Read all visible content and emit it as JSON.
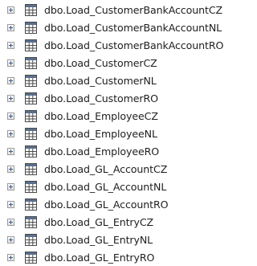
{
  "tree": {
    "items": [
      {
        "label": "dbo.Load_CustomerBankAccountCZ"
      },
      {
        "label": "dbo.Load_CustomerBankAccountNL"
      },
      {
        "label": "dbo.Load_CustomerBankAccountRO"
      },
      {
        "label": "dbo.Load_CustomerCZ"
      },
      {
        "label": "dbo.Load_CustomerNL"
      },
      {
        "label": "dbo.Load_CustomerRO"
      },
      {
        "label": "dbo.Load_EmployeeCZ"
      },
      {
        "label": "dbo.Load_EmployeeNL"
      },
      {
        "label": "dbo.Load_EmployeeRO"
      },
      {
        "label": "dbo.Load_GL_AccountCZ"
      },
      {
        "label": "dbo.Load_GL_AccountNL"
      },
      {
        "label": "dbo.Load_GL_AccountRO"
      },
      {
        "label": "dbo.Load_GL_EntryCZ"
      },
      {
        "label": "dbo.Load_GL_EntryNL"
      },
      {
        "label": "dbo.Load_GL_EntryRO"
      }
    ],
    "expander_icon": "plus-expander-icon",
    "item_icon": "table-icon"
  }
}
